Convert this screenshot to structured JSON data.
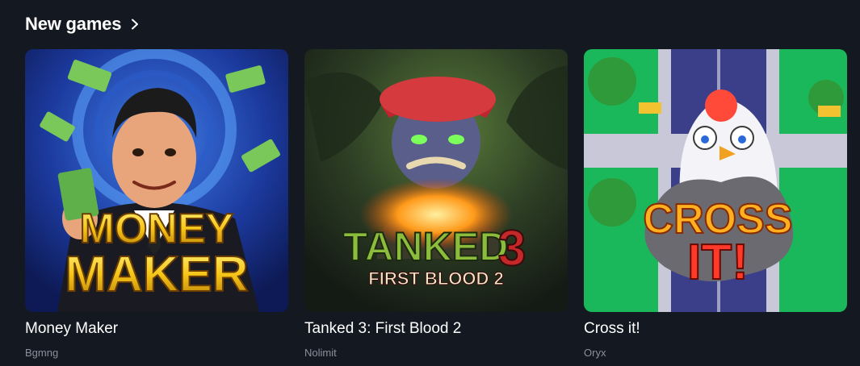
{
  "section": {
    "title": "New games",
    "icon": "chevron-right-icon"
  },
  "games": [
    {
      "title": "Money Maker",
      "provider": "Bgmng",
      "art_lines": [
        "MONEY",
        "MAKER"
      ],
      "colors": {
        "bg": "#1f3a9e",
        "text": "#f5c518"
      }
    },
    {
      "title": "Tanked 3: First Blood 2",
      "provider": "Nolimit",
      "art_lines": [
        "TANKED",
        "3",
        "FIRST BLOOD 2"
      ],
      "colors": {
        "bg": "#27351f",
        "text": "#7fa63a"
      }
    },
    {
      "title": "Cross it!",
      "provider": "Oryx",
      "art_lines": [
        "CROSS",
        "IT!"
      ],
      "colors": {
        "bg": "#1ab85a",
        "text": "#ff6a2a"
      }
    }
  ]
}
